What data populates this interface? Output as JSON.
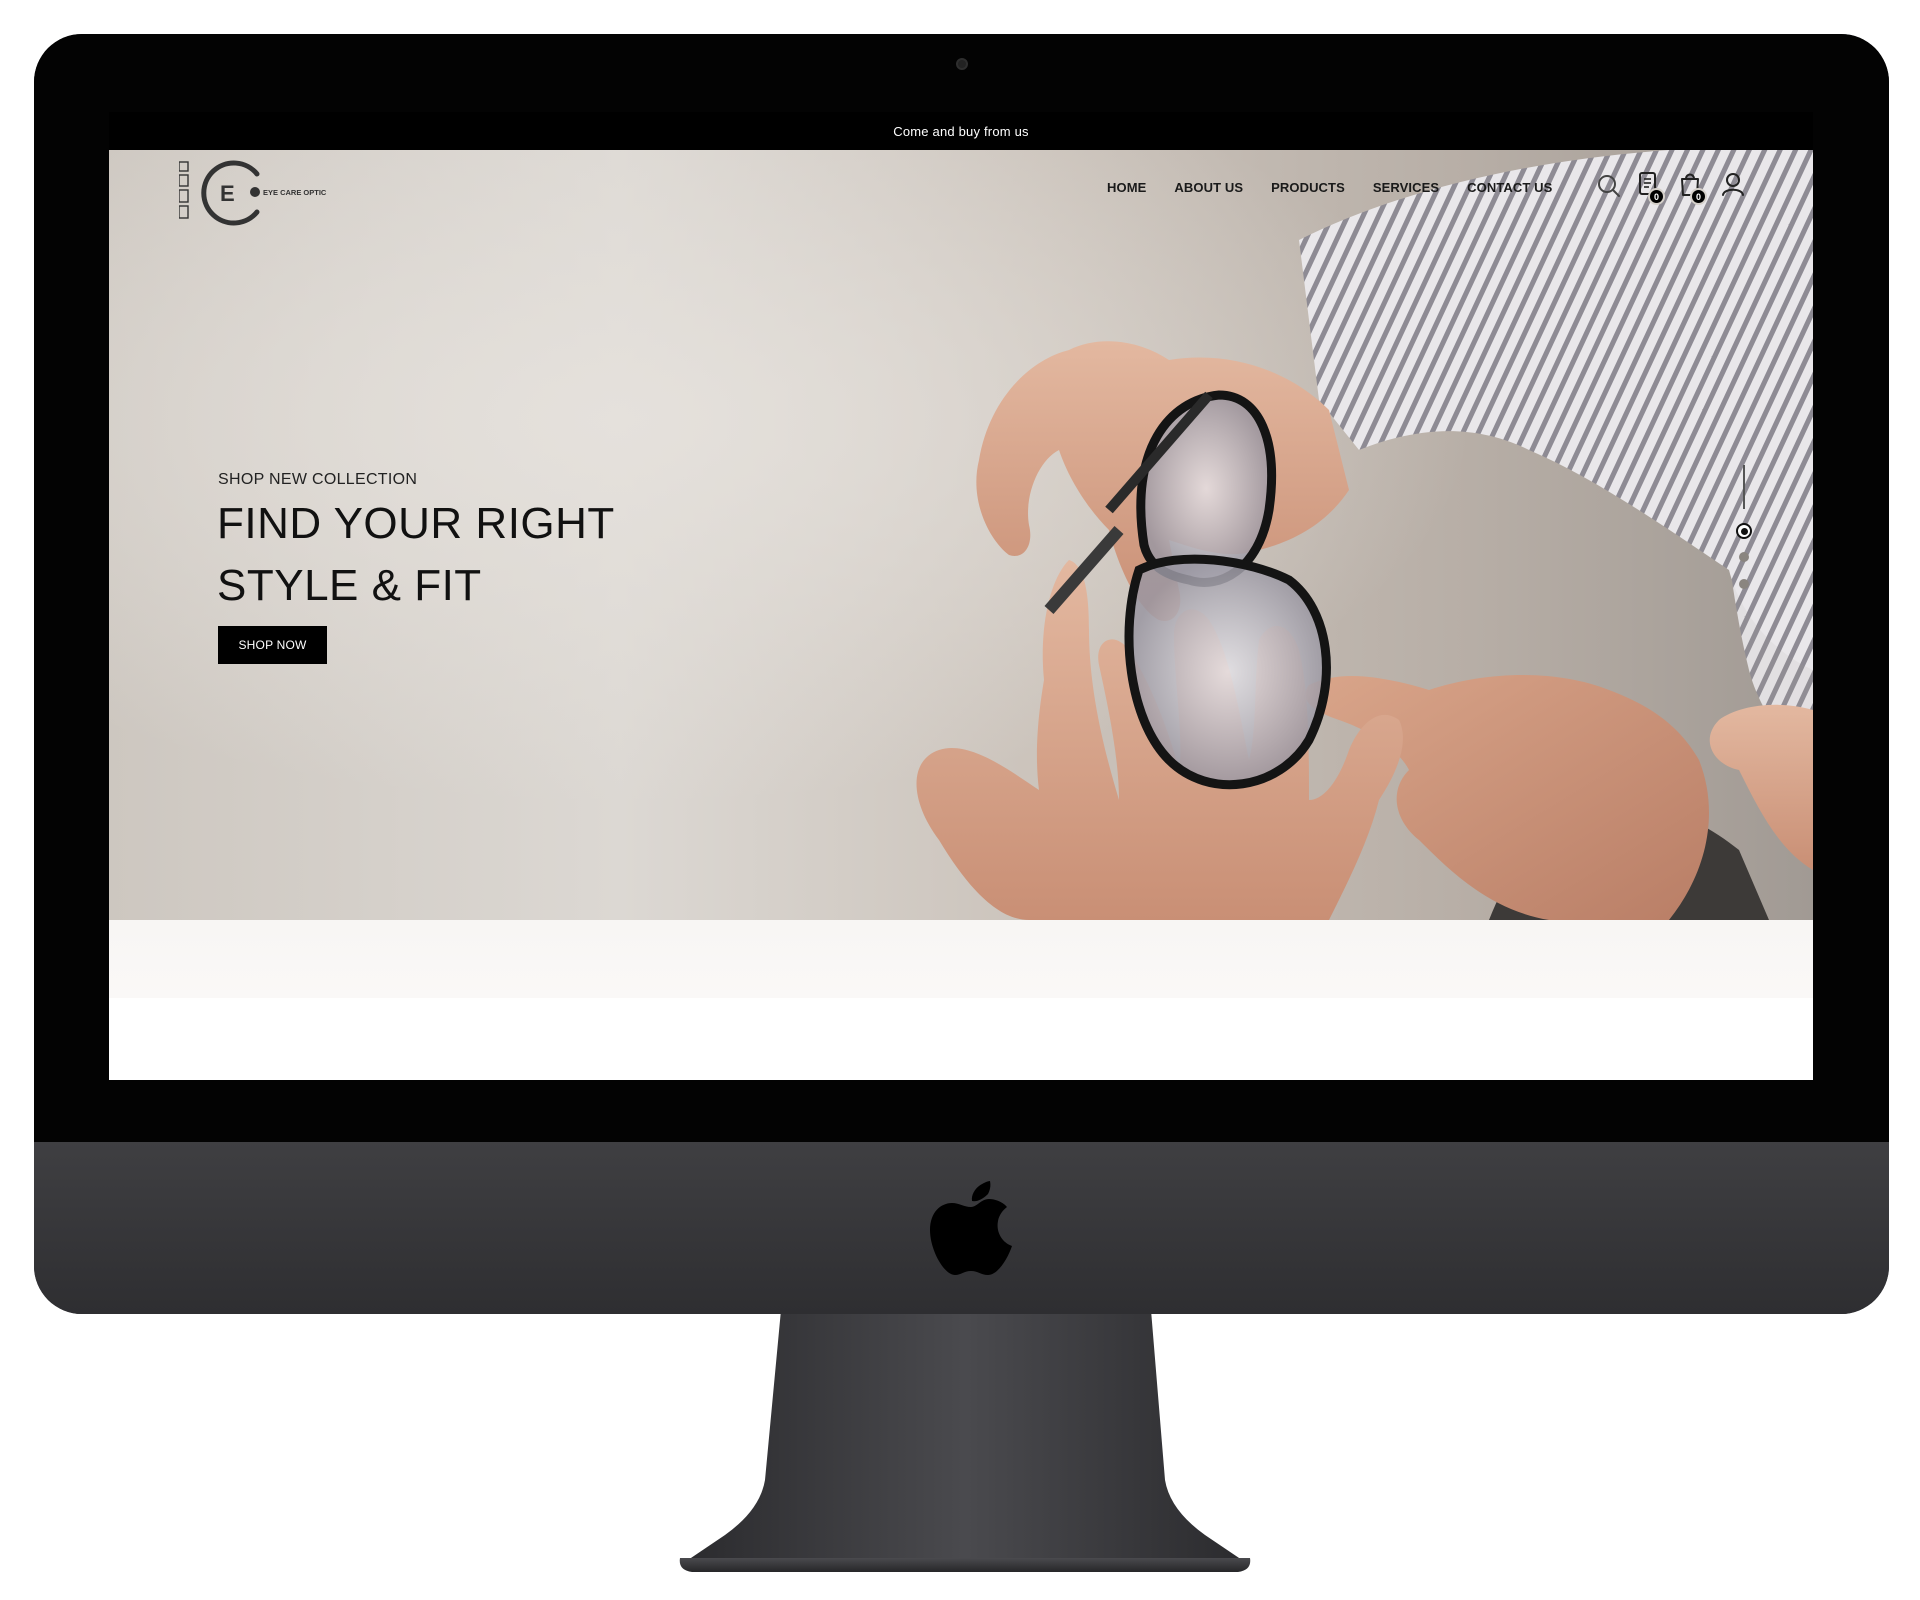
{
  "announcement": {
    "text": "Come and buy from us"
  },
  "brand": {
    "logo_text": "EYE CARE OPTIC",
    "logo_letter": "E"
  },
  "nav": {
    "items": [
      "HOME",
      "ABOUT US",
      "PRODUCTS",
      "SERVICES",
      "CONTACT US"
    ],
    "icons": [
      "search-icon",
      "compare-icon",
      "cart-icon",
      "user-icon"
    ],
    "compare_count": "0",
    "cart_count": "0"
  },
  "hero": {
    "eyebrow": "SHOP NEW COLLECTION",
    "title_line1": "FIND YOUR RIGHT",
    "title_line2": "STYLE & FIT",
    "cta_label": "SHOP NOW",
    "slides_total": 3,
    "active_slide": 1
  },
  "colors": {
    "accent": "#000000",
    "text": "#111111",
    "bezel": "#030303",
    "chassis": "#3a3a3d"
  }
}
